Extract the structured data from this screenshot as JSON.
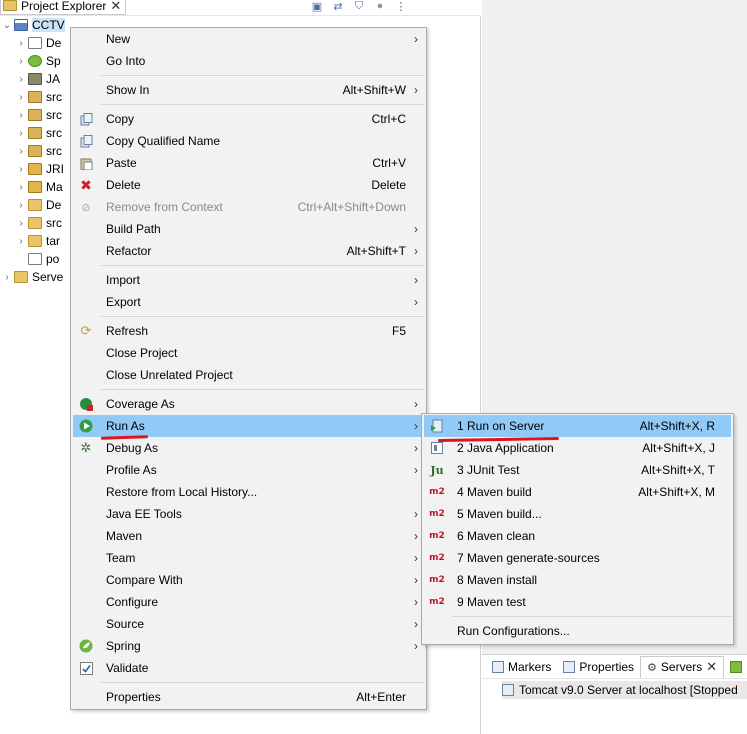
{
  "explorer": {
    "title": "Project Explorer",
    "tree": [
      {
        "label": "CCTV",
        "icon": "project-icon",
        "expanded": true
      },
      {
        "label": "De",
        "icon": "deployment-icon"
      },
      {
        "label": "Sp",
        "icon": "spring-icon"
      },
      {
        "label": "JA",
        "icon": "jax-ws-icon"
      },
      {
        "label": "src",
        "icon": "source-folder-icon"
      },
      {
        "label": "src",
        "icon": "source-folder-icon"
      },
      {
        "label": "src",
        "icon": "source-folder-icon"
      },
      {
        "label": "src",
        "icon": "source-folder-icon"
      },
      {
        "label": "JRI",
        "icon": "library-icon"
      },
      {
        "label": "Ma",
        "icon": "library-icon"
      },
      {
        "label": "De",
        "icon": "folder-icon"
      },
      {
        "label": "src",
        "icon": "folder-icon"
      },
      {
        "label": "tar",
        "icon": "folder-icon"
      },
      {
        "label": "po",
        "icon": "xml-file-icon"
      },
      {
        "label": "Serve",
        "icon": "folder-icon"
      }
    ]
  },
  "context_menu": {
    "items": [
      {
        "label": "New",
        "shortcut": "",
        "submenu": true
      },
      {
        "label": "Go Into",
        "shortcut": ""
      },
      {
        "label": "Show In",
        "shortcut": "Alt+Shift+W",
        "submenu": true
      },
      {
        "label": "Copy",
        "shortcut": "Ctrl+C",
        "icon": "copy-icon"
      },
      {
        "label": "Copy Qualified Name",
        "shortcut": "",
        "icon": "copy-qualified-icon"
      },
      {
        "label": "Paste",
        "shortcut": "Ctrl+V",
        "icon": "paste-icon"
      },
      {
        "label": "Delete",
        "shortcut": "Delete",
        "icon": "delete-icon"
      },
      {
        "label": "Remove from Context",
        "shortcut": "Ctrl+Alt+Shift+Down",
        "icon": "remove-context-icon",
        "disabled": true
      },
      {
        "label": "Build Path",
        "shortcut": "",
        "submenu": true
      },
      {
        "label": "Refactor",
        "shortcut": "Alt+Shift+T",
        "submenu": true
      },
      {
        "label": "Import",
        "shortcut": "",
        "submenu": true
      },
      {
        "label": "Export",
        "shortcut": "",
        "submenu": true
      },
      {
        "label": "Refresh",
        "shortcut": "F5",
        "icon": "refresh-icon"
      },
      {
        "label": "Close Project",
        "shortcut": ""
      },
      {
        "label": "Close Unrelated Project",
        "shortcut": ""
      },
      {
        "label": "Coverage As",
        "shortcut": "",
        "submenu": true,
        "icon": "coverage-icon"
      },
      {
        "label": "Run As",
        "shortcut": "",
        "submenu": true,
        "icon": "run-icon",
        "highlighted": true
      },
      {
        "label": "Debug As",
        "shortcut": "",
        "submenu": true,
        "icon": "debug-icon"
      },
      {
        "label": "Profile As",
        "shortcut": "",
        "submenu": true
      },
      {
        "label": "Restore from Local History...",
        "shortcut": ""
      },
      {
        "label": "Java EE Tools",
        "shortcut": "",
        "submenu": true
      },
      {
        "label": "Maven",
        "shortcut": "",
        "submenu": true
      },
      {
        "label": "Team",
        "shortcut": "",
        "submenu": true
      },
      {
        "label": "Compare With",
        "shortcut": "",
        "submenu": true
      },
      {
        "label": "Configure",
        "shortcut": "",
        "submenu": true
      },
      {
        "label": "Source",
        "shortcut": "",
        "submenu": true
      },
      {
        "label": "Spring",
        "shortcut": "",
        "submenu": true,
        "icon": "spring-icon"
      },
      {
        "label": "Validate",
        "shortcut": "",
        "icon": "validate-icon"
      },
      {
        "label": "Properties",
        "shortcut": "Alt+Enter"
      }
    ]
  },
  "run_as_submenu": {
    "items": [
      {
        "label": "1 Run on Server",
        "shortcut": "Alt+Shift+X, R",
        "icon": "run-on-server-icon",
        "highlighted": true
      },
      {
        "label": "2 Java Application",
        "shortcut": "Alt+Shift+X, J",
        "icon": "java-application-icon"
      },
      {
        "label": "3 JUnit Test",
        "shortcut": "Alt+Shift+X, T",
        "icon": "junit-icon",
        "glyph": "Ju"
      },
      {
        "label": "4 Maven build",
        "shortcut": "Alt+Shift+X, M",
        "icon": "maven-icon",
        "glyph": "m2"
      },
      {
        "label": "5 Maven build...",
        "shortcut": "",
        "icon": "maven-icon",
        "glyph": "m2"
      },
      {
        "label": "6 Maven clean",
        "shortcut": "",
        "icon": "maven-icon",
        "glyph": "m2"
      },
      {
        "label": "7 Maven generate-sources",
        "shortcut": "",
        "icon": "maven-icon",
        "glyph": "m2"
      },
      {
        "label": "8 Maven install",
        "shortcut": "",
        "icon": "maven-icon",
        "glyph": "m2"
      },
      {
        "label": "9 Maven test",
        "shortcut": "",
        "icon": "maven-icon",
        "glyph": "m2"
      },
      {
        "label": "Run Configurations...",
        "shortcut": ""
      }
    ]
  },
  "servers_view": {
    "tabs": [
      {
        "label": "Markers"
      },
      {
        "label": "Properties"
      },
      {
        "label": "Servers"
      }
    ],
    "server_row": "Tomcat v9.0 Server at localhost  [Stopped"
  },
  "colors": {
    "highlight": "#91c9f7",
    "annotation_red": "#e0141c",
    "menu_bg": "#f2f2f2"
  }
}
